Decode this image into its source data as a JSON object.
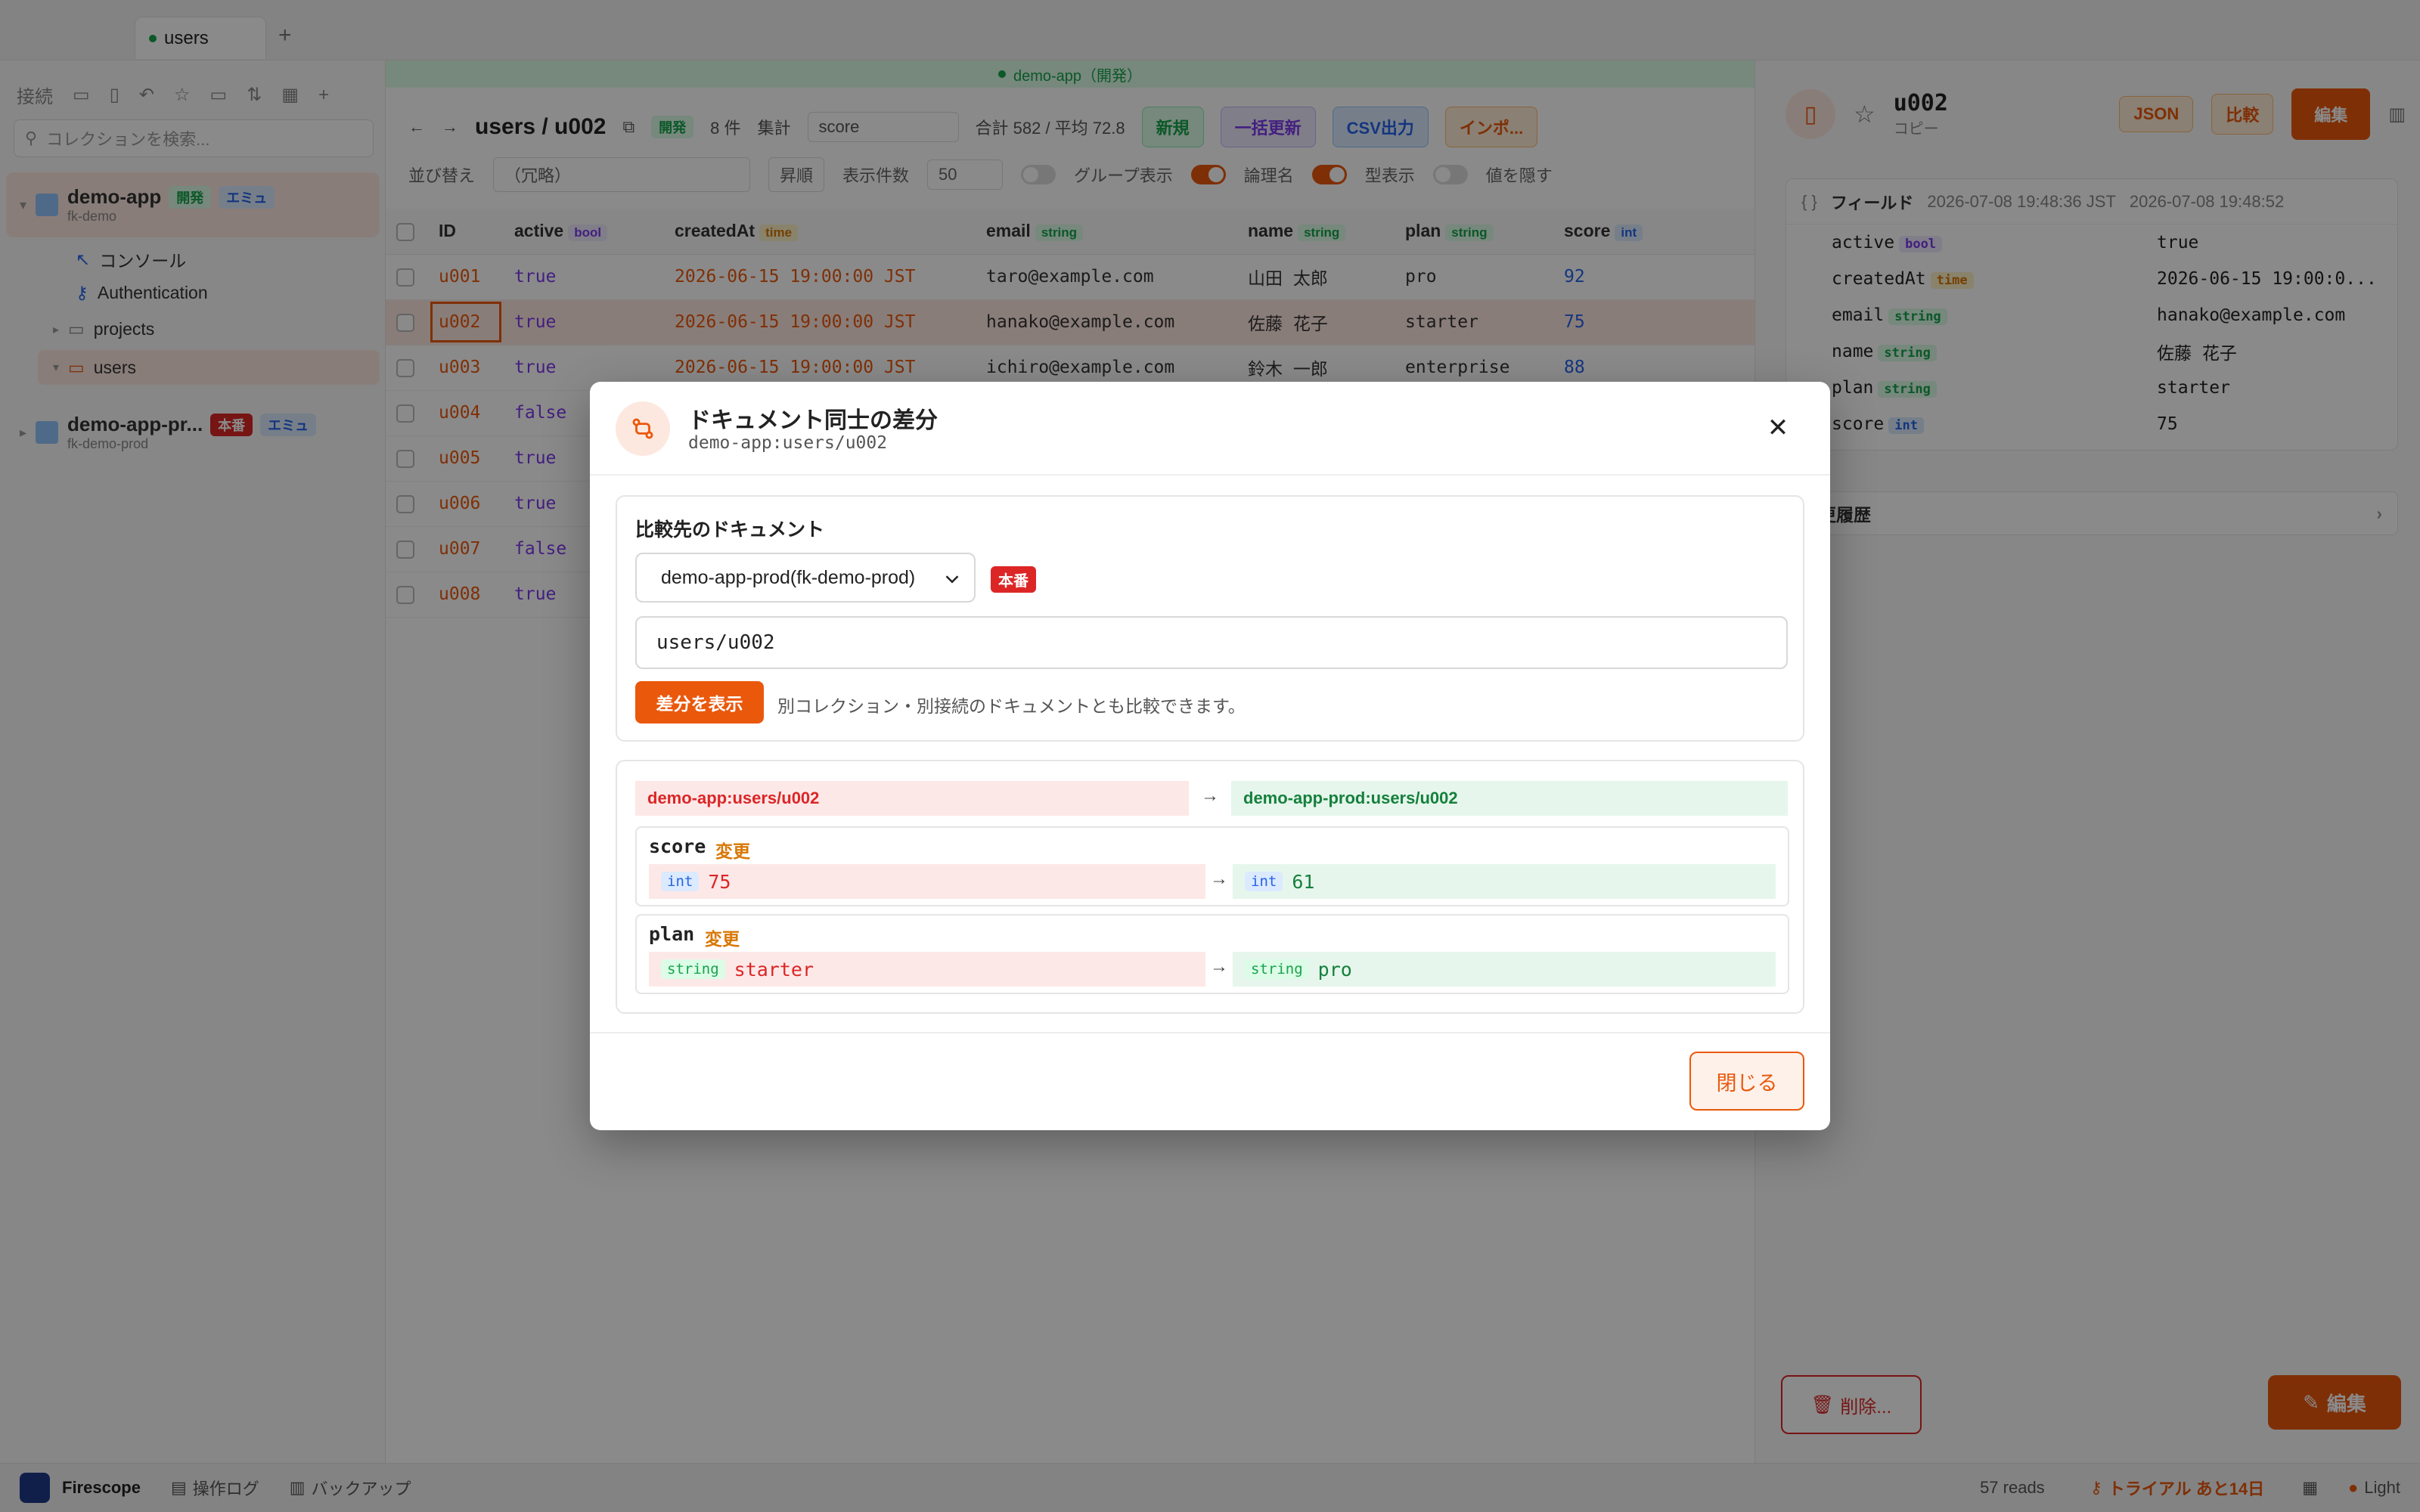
{
  "tabs": [
    {
      "label": "users"
    }
  ],
  "sidebar": {
    "toolbar_label": "接続",
    "search_placeholder": "コレクションを検索...",
    "connections": [
      {
        "name": "demo-app",
        "sub": "fk-demo",
        "badges": [
          "開発",
          "エミュ"
        ]
      },
      {
        "name": "demo-app-pr...",
        "sub": "fk-demo-prod",
        "badges": [
          "本番",
          "エミュ"
        ]
      }
    ],
    "items": [
      {
        "label": "コンソール"
      },
      {
        "label": "Authentication"
      },
      {
        "label": "projects"
      },
      {
        "label": "users"
      }
    ]
  },
  "main": {
    "banner": "demo-app（開発）",
    "path": "users / u002",
    "badge": "開発",
    "count": "8 件",
    "agg_label": "集計",
    "agg_field": "score",
    "agg_value": "合計 582 / 平均 72.8",
    "buttons": [
      "新規",
      "一括更新",
      "CSV出力",
      "インポ..."
    ],
    "sort_label": "並び替え",
    "sort_value": "（冗略）",
    "order": "昇順",
    "page_label": "表示件数",
    "page_size": "50",
    "toggles": [
      "グループ表示",
      "論理名",
      "型表示",
      "値を隠す"
    ],
    "columns": [
      {
        "name": "ID",
        "type": ""
      },
      {
        "name": "active",
        "type": "bool"
      },
      {
        "name": "createdAt",
        "type": "time"
      },
      {
        "name": "email",
        "type": "string"
      },
      {
        "name": "name",
        "type": "string"
      },
      {
        "name": "plan",
        "type": "string"
      },
      {
        "name": "score",
        "type": "int"
      }
    ],
    "rows": [
      {
        "id": "u001",
        "active": "true",
        "createdAt": "2026-06-15 19:00:00 JST",
        "email": "taro@example.com",
        "name": "山田 太郎",
        "plan": "pro",
        "score": "92"
      },
      {
        "id": "u002",
        "active": "true",
        "createdAt": "2026-06-15 19:00:00 JST",
        "email": "hanako@example.com",
        "name": "佐藤 花子",
        "plan": "starter",
        "score": "75"
      },
      {
        "id": "u003",
        "active": "true",
        "createdAt": "2026-06-15 19:00:00 JST",
        "email": "ichiro@example.com",
        "name": "鈴木 一郎",
        "plan": "enterprise",
        "score": "88"
      },
      {
        "id": "u004",
        "active": "false",
        "createdAt": "",
        "email": "",
        "name": "",
        "plan": "",
        "score": ""
      },
      {
        "id": "u005",
        "active": "true",
        "createdAt": "",
        "email": "",
        "name": "",
        "plan": "",
        "score": ""
      },
      {
        "id": "u006",
        "active": "true",
        "createdAt": "",
        "email": "",
        "name": "",
        "plan": "",
        "score": ""
      },
      {
        "id": "u007",
        "active": "false",
        "createdAt": "",
        "email": "",
        "name": "",
        "plan": "",
        "score": ""
      },
      {
        "id": "u008",
        "active": "true",
        "createdAt": "",
        "email": "",
        "name": "",
        "plan": "",
        "score": ""
      }
    ]
  },
  "right": {
    "title": "u002",
    "subtitle": "コピー",
    "json_label": "JSON",
    "compare_label": "比較",
    "edit_label": "編集",
    "fields_label": "フィールド",
    "created": "2026-07-08 19:48:36 JST",
    "updated": "2026-07-08 19:48:52",
    "fields": [
      {
        "key": "active",
        "type": "bool",
        "value": "true"
      },
      {
        "key": "createdAt",
        "type": "time",
        "value": "2026-06-15 19:00:0..."
      },
      {
        "key": "email",
        "type": "string",
        "value": "hanako@example.com"
      },
      {
        "key": "name",
        "type": "string",
        "value": "佐藤 花子"
      },
      {
        "key": "plan",
        "type": "string",
        "value": "starter"
      },
      {
        "key": "score",
        "type": "int",
        "value": "75"
      }
    ],
    "history_label": "変更履歴",
    "delete_label": "削除...",
    "edit_bottom_label": "編集"
  },
  "statusbar": {
    "app": "Firescope",
    "log": "操作ログ",
    "backup": "バックアップ",
    "reads": "57 reads",
    "trial": "トライアル あと14日",
    "theme": "Light"
  },
  "modal": {
    "title": "ドキュメント同士の差分",
    "subtitle": "demo-app:users/u002",
    "target_label": "比較先のドキュメント",
    "connection_value": "demo-app-prod(fk-demo-prod)",
    "prod_badge": "本番",
    "path_value": "users/u002",
    "diff_button": "差分を表示",
    "hint": "別コレクション・別接続のドキュメントとも比較できます。",
    "source_left": "demo-app:users/u002",
    "source_right": "demo-app-prod:users/u002",
    "diffs": [
      {
        "field": "score",
        "change": "変更",
        "old_type": "int",
        "old_value": "75",
        "new_type": "int",
        "new_value": "61"
      },
      {
        "field": "plan",
        "change": "変更",
        "old_type": "string",
        "old_value": "starter",
        "new_type": "string",
        "new_value": "pro"
      }
    ],
    "close_label": "閉じる"
  },
  "colors": {
    "accent": "#ea580c",
    "danger": "#dc2626",
    "success": "#16a34a"
  }
}
